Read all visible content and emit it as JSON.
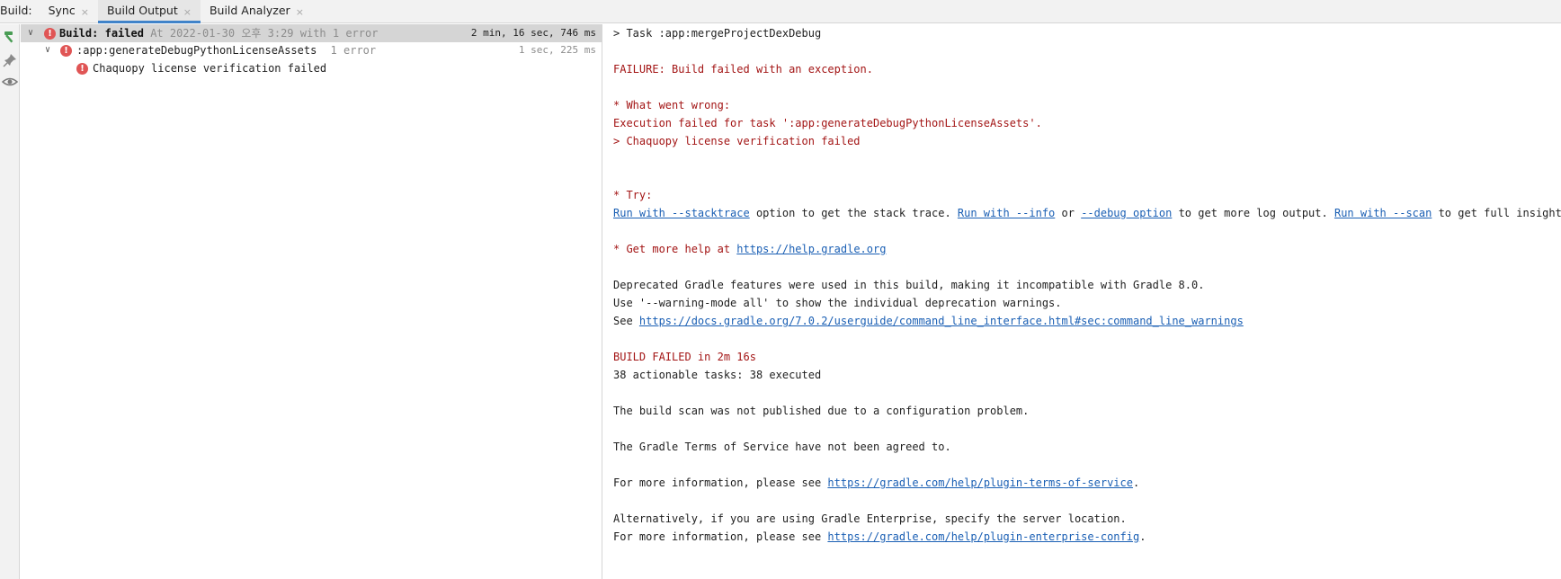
{
  "tabbar": {
    "build_label": "Build:",
    "tabs": [
      {
        "label": "Sync",
        "close": "×"
      },
      {
        "label": "Build Output",
        "close": "×"
      },
      {
        "label": "Build Analyzer",
        "close": "×"
      }
    ]
  },
  "tree": {
    "root": {
      "chevron": "∨",
      "label": "Build:",
      "status": "failed",
      "detail": "At 2022-01-30 오후 3:29 with 1 error",
      "duration": "2 min, 16 sec, 746 ms"
    },
    "task": {
      "chevron": "∨",
      "label": ":app:generateDebugPythonLicenseAssets",
      "detail": "1 error",
      "duration": "1 sec, 225 ms"
    },
    "error": {
      "label": "Chaquopy license verification failed"
    },
    "error_icon_glyph": "!"
  },
  "console": {
    "task_line": "> Task :app:mergeProjectDexDebug",
    "failure": "FAILURE: Build failed with an exception.",
    "what_went_wrong": "* What went wrong:",
    "execution_failed": "Execution failed for task ':app:generateDebugPythonLicenseAssets'.",
    "verification_failed": "> Chaquopy license verification failed",
    "try": "* Try:",
    "try_line": {
      "link1": "Run with --stacktrace",
      "text1": " option to get the stack trace. ",
      "link2": "Run with --info",
      "text2": " or ",
      "link3": "--debug option",
      "text3": " to get more log output. ",
      "link4": "Run with --scan",
      "text4": " to get full insights."
    },
    "help_prefix": "* Get more help at ",
    "help_link": "https://help.gradle.org",
    "deprecated": "Deprecated Gradle features were used in this build, making it incompatible with Gradle 8.0.",
    "warning_mode": "Use '--warning-mode all' to show the individual deprecation warnings.",
    "see_prefix": "See ",
    "see_link": "https://docs.gradle.org/7.0.2/userguide/command_line_interface.html#sec:command_line_warnings",
    "build_failed": "BUILD FAILED in 2m 16s",
    "tasks": "38 actionable tasks: 38 executed",
    "scan_not_published": "The build scan was not published due to a configuration problem.",
    "terms_not_agreed": "The Gradle Terms of Service have not been agreed to.",
    "more_info_prefix": "For more information, please see ",
    "terms_link": "https://gradle.com/help/plugin-terms-of-service",
    "period": ".",
    "alternatively": "Alternatively, if you are using Gradle Enterprise, specify the server location.",
    "enterprise_link": "https://gradle.com/help/plugin-enterprise-config"
  },
  "colors": {
    "error_red": "#a31515",
    "link_blue": "#1a5fb4",
    "active_tab_accent": "#4083c9",
    "error_icon": "#e05555"
  },
  "icons": {
    "toolstrip": [
      "hammer-icon",
      "pin-icon",
      "eye-icon"
    ]
  }
}
